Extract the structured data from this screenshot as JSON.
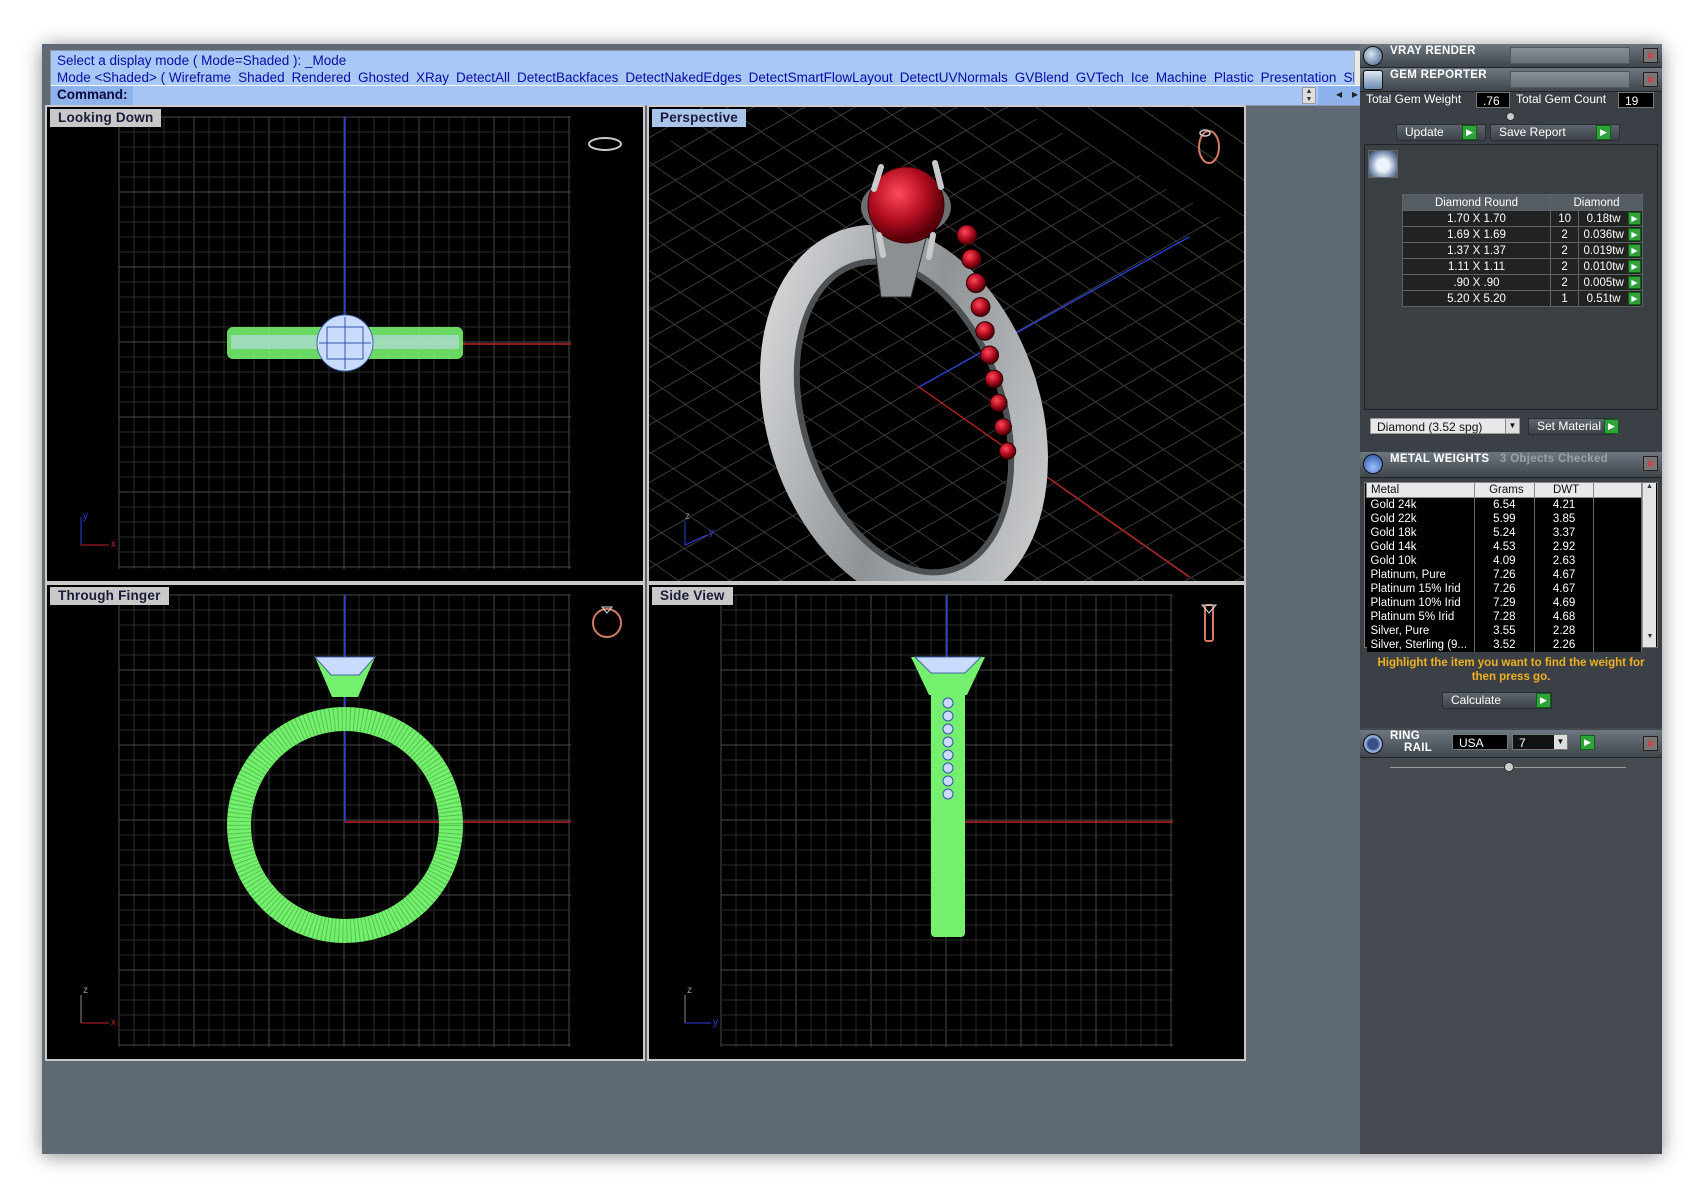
{
  "command": {
    "line1": "Select a display mode ( Mode=Shaded ): _Mode",
    "line2_prefix": "Mode <Shaded> ( Wireframe",
    "modes": [
      "Shaded",
      "Rendered",
      "Ghosted",
      "XRay",
      "DetectAll",
      "DetectBackfaces",
      "DetectNakedEdges",
      "DetectSmartFlowLayout",
      "DetectUVNormals",
      "GVBlend",
      "GVTech",
      "Ice",
      "Machine",
      "Plastic",
      "Presentation",
      "Shi"
    ],
    "label": "Command:",
    "value": ""
  },
  "viewports": {
    "top": {
      "label": "Looking Down",
      "axis_a": "y",
      "axis_b": "x"
    },
    "perspective": {
      "label": "Perspective",
      "axis_a": "z",
      "axis_b": "y"
    },
    "front": {
      "label": "Through Finger",
      "axis_a": "z",
      "axis_b": "x"
    },
    "right": {
      "label": "Side View",
      "axis_a": "z",
      "axis_b": "y"
    }
  },
  "vray": {
    "title": "VRAY RENDER"
  },
  "gem_reporter": {
    "title": "GEM REPORTER",
    "total_weight_label": "Total Gem Weight",
    "total_weight": ".76",
    "total_count_label": "Total Gem Count",
    "total_count": "19",
    "update_label": "Update",
    "save_label": "Save Report",
    "header_shape": "Diamond Round",
    "header_material": "Diamond",
    "rows": [
      {
        "size": "1.70 X 1.70",
        "qty": "10",
        "weight": "0.18tw"
      },
      {
        "size": "1.69 X 1.69",
        "qty": "2",
        "weight": "0.036tw"
      },
      {
        "size": "1.37 X 1.37",
        "qty": "2",
        "weight": "0.019tw"
      },
      {
        "size": "1.11 X 1.11",
        "qty": "2",
        "weight": "0.010tw"
      },
      {
        "size": ".90 X .90",
        "qty": "2",
        "weight": "0.005tw"
      },
      {
        "size": "5.20 X 5.20",
        "qty": "1",
        "weight": "0.51tw"
      }
    ],
    "material_select": "Diamond    (3.52 spg)",
    "set_material_label": "Set Material"
  },
  "metal_weights": {
    "title": "METAL WEIGHTS",
    "status": "3 Objects Checked",
    "headers": [
      "Metal",
      "Grams",
      "DWT"
    ],
    "rows": [
      {
        "metal": "Gold 24k",
        "grams": "6.54",
        "dwt": "4.21"
      },
      {
        "metal": "Gold 22k",
        "grams": "5.99",
        "dwt": "3.85"
      },
      {
        "metal": "Gold 18k",
        "grams": "5.24",
        "dwt": "3.37"
      },
      {
        "metal": "Gold 14k",
        "grams": "4.53",
        "dwt": "2.92"
      },
      {
        "metal": "Gold 10k",
        "grams": "4.09",
        "dwt": "2.63"
      },
      {
        "metal": "Platinum, Pure",
        "grams": "7.26",
        "dwt": "4.67"
      },
      {
        "metal": "Platinum 15% Irid",
        "grams": "7.26",
        "dwt": "4.67"
      },
      {
        "metal": "Platinum 10% Irid",
        "grams": "7.29",
        "dwt": "4.69"
      },
      {
        "metal": "Platinum 5% Irid",
        "grams": "7.28",
        "dwt": "4.68"
      },
      {
        "metal": "Silver, Pure",
        "grams": "3.55",
        "dwt": "2.28"
      },
      {
        "metal": "Silver, Sterling (9...",
        "grams": "3.52",
        "dwt": "2.26"
      }
    ],
    "hint": "Highlight the item you want to find the weight for then press go.",
    "calculate_label": "Calculate"
  },
  "ring_rail": {
    "title_line1": "RING",
    "title_line2": "RAIL",
    "standard": "USA",
    "size": "7"
  },
  "colors": {
    "wire": "#74f06e",
    "gem_select": "#a8c8ff",
    "ruby": "#c8102e",
    "metal": "#a9acae"
  }
}
